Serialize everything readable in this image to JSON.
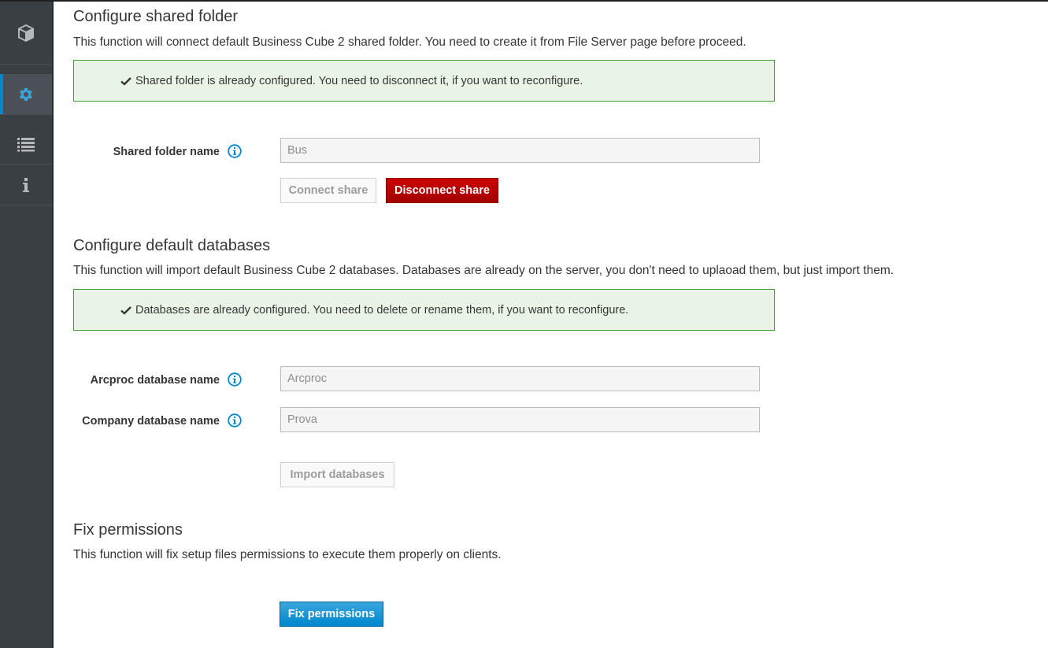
{
  "sidebar": {
    "items": [
      {
        "icon": "cube-icon",
        "active": false
      },
      {
        "icon": "gear-icon",
        "active": true
      },
      {
        "icon": "list-icon",
        "active": false
      },
      {
        "icon": "info-icon",
        "active": false
      }
    ]
  },
  "shared_folder": {
    "title": "Configure shared folder",
    "description": "This function will connect default Business Cube 2 shared folder. You need to create it from File Server page before proceed.",
    "alert": "Shared folder is already configured. You need to disconnect it, if you want to reconfigure.",
    "field_label": "Shared folder name",
    "field_value": "Bus",
    "connect_label": "Connect share",
    "disconnect_label": "Disconnect share"
  },
  "databases": {
    "title": "Configure default databases",
    "description": "This function will import default Business Cube 2 databases. Databases are already on the server, you don't need to uplaoad them, but just import them.",
    "alert": "Databases are already configured. You need to delete or rename them, if you want to reconfigure.",
    "arcproc_label": "Arcproc database name",
    "arcproc_value": "Arcproc",
    "company_label": "Company database name",
    "company_value": "Prova",
    "import_label": "Import databases"
  },
  "permissions": {
    "title": "Fix permissions",
    "description": "This function will fix setup files permissions to execute them properly on clients.",
    "fix_label": "Fix permissions"
  },
  "colors": {
    "sidebar_bg": "#3a3f44",
    "accent": "#0088ce",
    "success_bg": "#e9f4e6",
    "success_border": "#3f9c35",
    "danger": "#c00000"
  }
}
